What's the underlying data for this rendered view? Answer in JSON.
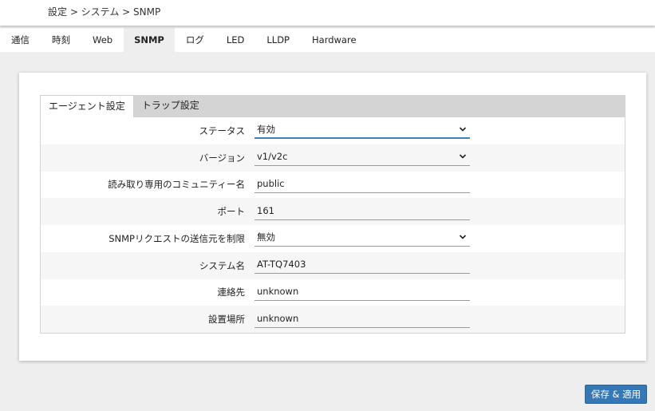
{
  "breadcrumb": "設定 > システム > SNMP",
  "nav": {
    "tabs": [
      {
        "label": "通信",
        "active": false
      },
      {
        "label": "時刻",
        "active": false
      },
      {
        "label": "Web",
        "active": false
      },
      {
        "label": "SNMP",
        "active": true
      },
      {
        "label": "ログ",
        "active": false
      },
      {
        "label": "LED",
        "active": false
      },
      {
        "label": "LLDP",
        "active": false
      },
      {
        "label": "Hardware",
        "active": false
      }
    ]
  },
  "subtabs": [
    {
      "label": "エージェント設定",
      "active": true
    },
    {
      "label": "トラップ設定",
      "active": false
    }
  ],
  "form": {
    "rows": [
      {
        "label": "ステータス",
        "value": "有効",
        "type": "select",
        "focused": true
      },
      {
        "label": "バージョン",
        "value": "v1/v2c",
        "type": "select",
        "focused": false
      },
      {
        "label": "読み取り専用のコミュニティー名",
        "value": "public",
        "type": "text",
        "focused": false
      },
      {
        "label": "ポート",
        "value": "161",
        "type": "text",
        "focused": false
      },
      {
        "label": "SNMPリクエストの送信元を制限",
        "value": "無効",
        "type": "select",
        "focused": false
      },
      {
        "label": "システム名",
        "value": "AT-TQ7403",
        "type": "text",
        "focused": false
      },
      {
        "label": "連絡先",
        "value": "unknown",
        "type": "text",
        "focused": false
      },
      {
        "label": "設置場所",
        "value": "unknown",
        "type": "text",
        "focused": false
      }
    ]
  },
  "actions": {
    "save_label": "保存 & 適用"
  },
  "colors": {
    "accent": "#3677b5",
    "focus_underline": "#3a82c4"
  },
  "icons": {
    "select_arrow": "chevron-down-icon"
  }
}
